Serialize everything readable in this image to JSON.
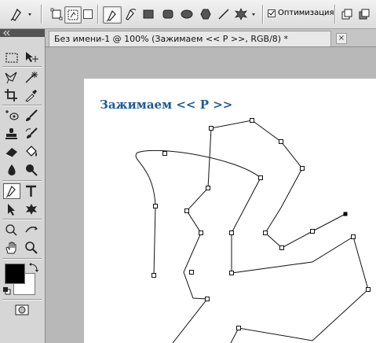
{
  "options_bar": {
    "auto_optimize_label": "Оптимизация",
    "auto_optimize_checked": true
  },
  "document": {
    "tab_title": "Без имени-1 @ 100% (Зажимаем << P >>, RGB/8) *",
    "close_label": "×",
    "canvas_heading": "Зажимаем << P >>"
  },
  "colors": {
    "foreground": "#000000",
    "background": "#ffffff",
    "heading": "#1e5a96"
  }
}
